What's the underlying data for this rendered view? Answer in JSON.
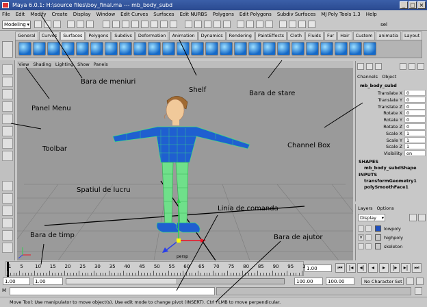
{
  "window": {
    "title": "Maya 6.0.1: H:\\source files\\boy_final.ma   ---   mb_body_subd"
  },
  "menubar": [
    "File",
    "Edit",
    "Modify",
    "Create",
    "Display",
    "Window",
    "Edit Curves",
    "Surfaces",
    "Edit NURBS",
    "Polygons",
    "Edit Polygons",
    "Subdiv Surfaces",
    "MJ Poly Tools 1.3",
    "Help"
  ],
  "statusline": {
    "mode": "Modeling",
    "right_text": "sel"
  },
  "shelf_tabs": [
    "General",
    "Curves",
    "Surfaces",
    "Polygons",
    "Subdivs",
    "Deformation",
    "Animation",
    "Dynamics",
    "Rendering",
    "PaintEffects",
    "Cloth",
    "Fluids",
    "Fur",
    "Hair",
    "Custom",
    "animatia",
    "Layout"
  ],
  "shelf_active": "Surfaces",
  "viewport": {
    "menu": [
      "View",
      "Shading",
      "Lighting",
      "Show",
      "Panels"
    ],
    "camera_label": "persp"
  },
  "channel_box": {
    "tabs": [
      "Channels",
      "Object"
    ],
    "object_name": "mb_body_subd",
    "attributes": [
      {
        "name": "Translate X",
        "value": "0"
      },
      {
        "name": "Translate Y",
        "value": "0"
      },
      {
        "name": "Translate Z",
        "value": "0"
      },
      {
        "name": "Rotate X",
        "value": "0"
      },
      {
        "name": "Rotate Y",
        "value": "0"
      },
      {
        "name": "Rotate Z",
        "value": "0"
      },
      {
        "name": "Scale X",
        "value": "1"
      },
      {
        "name": "Scale Y",
        "value": "1"
      },
      {
        "name": "Scale Z",
        "value": "1"
      },
      {
        "name": "Visibility",
        "value": "on"
      }
    ],
    "shapes_header": "SHAPES",
    "shape_name": "mb_body_subdShape",
    "inputs_header": "INPUTS",
    "inputs": [
      "transformGeometry1",
      "polySmoothFace1"
    ]
  },
  "layers": {
    "tabs": [
      "Layers",
      "Options"
    ],
    "dropdown": "Display",
    "items": [
      {
        "name": "lowpoly",
        "visible": "",
        "color": "#1f4fbf"
      },
      {
        "name": "highpoly",
        "visible": "V",
        "color": "#c8c8c8"
      },
      {
        "name": "skeleton",
        "visible": "",
        "color": "#c8c8c8"
      }
    ]
  },
  "timeline": {
    "tick_labels": [
      "1",
      "5",
      "10",
      "15",
      "20",
      "25",
      "30",
      "35",
      "40",
      "45",
      "50",
      "55",
      "60",
      "65",
      "70",
      "75",
      "80",
      "85",
      "90",
      "95",
      "100"
    ],
    "current_frame": "1.00"
  },
  "range": {
    "start": "1.00",
    "playback_start": "1.00",
    "playback_end": "100.00",
    "end": "100.00",
    "character_set": "No Character Set"
  },
  "command_line": {
    "label": "M"
  },
  "help_line": "Move Tool: Use manipulator to move object(s). Use edit mode to change pivot (INSERT). Ctrl+LMB to move perpendicular.",
  "annotations": {
    "menu_bar": "Bara de meniuri",
    "shelf": "Shelf",
    "status_bar": "Bara de stare",
    "panel_menu": "Panel Menu",
    "channel_box": "Channel Box",
    "toolbar": "Toolbar",
    "workspace": "Spatiul de lucru",
    "command_line": "Linia de comanda",
    "help_bar": "Bara de ajutor",
    "time_bar": "Bara de timp"
  },
  "colors": {
    "title_bar": "#2a4a90",
    "mesh_blue": "#1f5fd0",
    "mesh_green": "#3ddc84",
    "viewport_bg": "#9a9a9a"
  }
}
